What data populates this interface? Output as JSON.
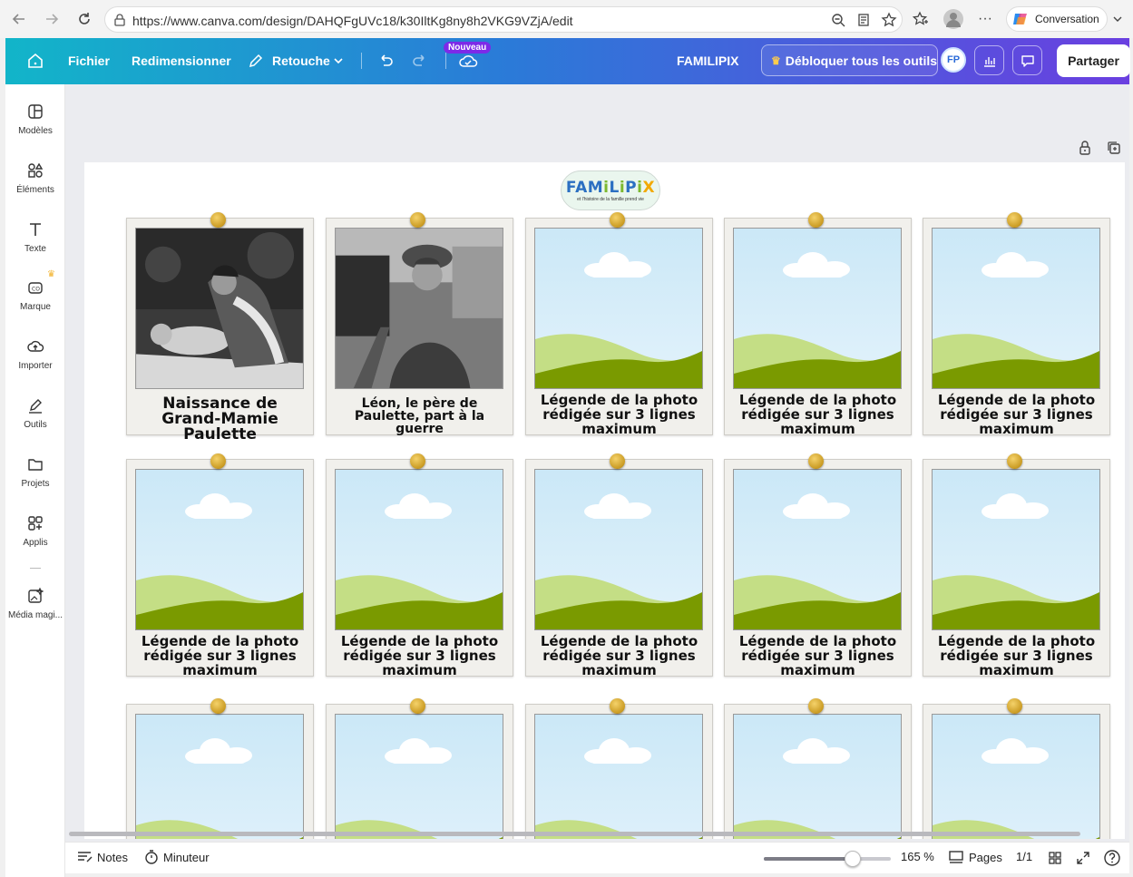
{
  "browser": {
    "url": "https://www.canva.com/design/DAHQFgUVc18/k30IltKg8ny8h2VKG9VZjA/edit",
    "conversation_label": "Conversation"
  },
  "toolbar": {
    "file_label": "Fichier",
    "resize_label": "Redimensionner",
    "retouch_label": "Retouche",
    "new_badge": "Nouveau",
    "design_name": "FAMILIPIX",
    "unlock_label": "Débloquer tous les outils",
    "avatar_initials": "FP",
    "share_label": "Partager"
  },
  "sidebar": {
    "items": [
      {
        "label": "Modèles",
        "icon": "templates-icon"
      },
      {
        "label": "Éléments",
        "icon": "elements-icon"
      },
      {
        "label": "Texte",
        "icon": "text-icon"
      },
      {
        "label": "Marque",
        "icon": "brand-icon"
      },
      {
        "label": "Importer",
        "icon": "upload-icon"
      },
      {
        "label": "Outils",
        "icon": "tools-icon"
      },
      {
        "label": "Projets",
        "icon": "folder-icon"
      },
      {
        "label": "Applis",
        "icon": "apps-icon"
      },
      {
        "label": "Média magi...",
        "icon": "magic-media-icon"
      }
    ]
  },
  "canvas": {
    "logo_text": "FAMiLiPiX",
    "logo_subtitle": "et l'histoire de la famille prend vie",
    "cards": [
      {
        "caption": "Naissance de Grand-Mamie Paulette",
        "photo": "baby"
      },
      {
        "caption": "Léon, le père de Paulette, part à la guerre",
        "photo": "soldier"
      },
      {
        "caption": "Légende de la photo rédigée sur 3 lignes maximum",
        "photo": "placeholder"
      },
      {
        "caption": "Légende de la photo rédigée sur 3 lignes maximum",
        "photo": "placeholder"
      },
      {
        "caption": "Légende de la photo rédigée sur 3 lignes maximum",
        "photo": "placeholder"
      },
      {
        "caption": "Légende de la photo rédigée sur 3 lignes maximum",
        "photo": "placeholder"
      },
      {
        "caption": "Légende de la photo rédigée sur 3 lignes maximum",
        "photo": "placeholder"
      },
      {
        "caption": "Légende de la photo rédigée sur 3 lignes maximum",
        "photo": "placeholder"
      },
      {
        "caption": "Légende de la photo rédigée sur 3 lignes maximum",
        "photo": "placeholder"
      },
      {
        "caption": "Légende de la photo rédigée sur 3 lignes maximum",
        "photo": "placeholder"
      },
      {
        "caption": "",
        "photo": "placeholder"
      },
      {
        "caption": "",
        "photo": "placeholder"
      },
      {
        "caption": "",
        "photo": "placeholder"
      },
      {
        "caption": "",
        "photo": "placeholder"
      },
      {
        "caption": "",
        "photo": "placeholder"
      }
    ]
  },
  "bottombar": {
    "notes_label": "Notes",
    "timer_label": "Minuteur",
    "zoom_label": "165 %",
    "zoom_fraction": 0.7,
    "pages_label": "Pages",
    "page_count": "1/1"
  },
  "colors": {
    "accent": "#7d2ae8",
    "grass_light": "#c4de85",
    "grass_dark": "#7a9a00"
  }
}
